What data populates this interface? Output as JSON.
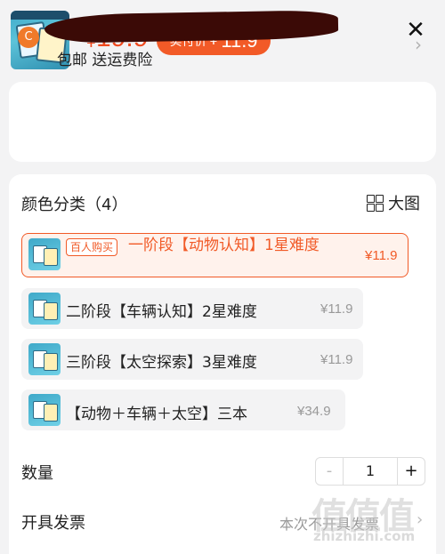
{
  "header": {
    "currency": "¥",
    "price": "19.9",
    "pay_label": "实付价",
    "pay_currency": "¥",
    "pay_price": "11.9",
    "close_icon": "close-icon"
  },
  "address": {
    "icon_letter": "C",
    "services": "包邮  送运费险"
  },
  "options": {
    "title": "颜色分类（4）",
    "big_image_label": "大图",
    "items": [
      {
        "tag": "百人购买",
        "label": "一阶段【动物认知】1星难度",
        "price": "¥11.9",
        "selected": true
      },
      {
        "label": "二阶段【车辆认知】2星难度",
        "price": "¥11.9",
        "selected": false
      },
      {
        "label": "三阶段【太空探索】3星难度",
        "price": "¥11.9",
        "selected": false
      },
      {
        "label": "【动物＋车辆＋太空】三本",
        "price": "¥34.9",
        "selected": false
      }
    ]
  },
  "quantity": {
    "label": "数量",
    "minus": "-",
    "value": "1",
    "plus": "+"
  },
  "invoice": {
    "label": "开具发票",
    "value": "本次不开具发票"
  },
  "watermark": {
    "chars": "值值值",
    "url": "zhizhizhi.com"
  },
  "colors": {
    "accent": "#f15a27",
    "price": "#ef4a1f"
  }
}
